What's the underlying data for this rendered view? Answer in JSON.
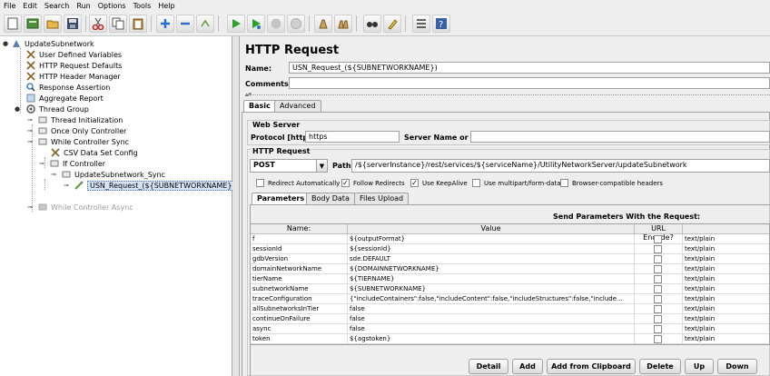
{
  "menu": [
    "File",
    "Edit",
    "Search",
    "Run",
    "Options",
    "Tools",
    "Help"
  ],
  "toolbar": {
    "icons": [
      "new-icon",
      "templates-icon",
      "open-icon",
      "save-icon",
      "cut-icon",
      "copy-icon",
      "paste-icon",
      "expand-icon",
      "collapse-icon",
      "toggle-icon",
      "start-icon",
      "start-no-pauses-icon",
      "stop-icon",
      "shutdown-icon",
      "clear-icon",
      "clear-all-icon",
      "search-icon",
      "reset-search-icon",
      "function-helper-icon",
      "help-icon"
    ]
  },
  "tree": {
    "items": [
      {
        "label": "UpdateSubnetwork",
        "icon": "test-plan-icon"
      },
      {
        "label": "User Defined Variables",
        "icon": "config-element-icon"
      },
      {
        "label": "HTTP Request Defaults",
        "icon": "config-element-icon"
      },
      {
        "label": "HTTP Header Manager",
        "icon": "config-element-icon"
      },
      {
        "label": "Response Assertion",
        "icon": "assertion-icon"
      },
      {
        "label": "Aggregate Report",
        "icon": "listener-icon"
      },
      {
        "label": "Thread Group",
        "icon": "thread-group-icon"
      },
      {
        "label": "Thread Initialization",
        "icon": "controller-icon"
      },
      {
        "label": "Once Only Controller",
        "icon": "controller-icon"
      },
      {
        "label": "While Controller Sync",
        "icon": "controller-icon"
      },
      {
        "label": "CSV Data Set Config",
        "icon": "config-element-icon"
      },
      {
        "label": "If Controller",
        "icon": "controller-icon"
      },
      {
        "label": "UpdateSubnetwork_Sync",
        "icon": "controller-icon"
      },
      {
        "label": "USN_Request_(${SUBNETWORKNAME})",
        "icon": "sampler-icon"
      },
      {
        "label": "While Controller Async",
        "icon": "controller-icon"
      }
    ]
  },
  "panel": {
    "title": "HTTP Request",
    "name_label": "Name:",
    "name_value": "USN_Request_(${SUBNETWORKNAME})",
    "comments_label": "Comments:",
    "comments_value": "",
    "tabs": [
      "Basic",
      "Advanced"
    ],
    "web_server_title": "Web Server",
    "protocol_label": "Protocol [http]:",
    "protocol_value": "https",
    "server_label": "Server Name or IP:",
    "server_value": "",
    "http_request_title": "HTTP Request",
    "method": "POST",
    "path_label": "Path:",
    "path_value": "/${serverInstance}/rest/services/${serviceName}/UtilityNetworkServer/updateSubnetwork",
    "checkboxes": [
      {
        "label": "Redirect Automatically",
        "checked": false
      },
      {
        "label": "Follow Redirects",
        "checked": true
      },
      {
        "label": "Use KeepAlive",
        "checked": true
      },
      {
        "label": "Use multipart/form-data",
        "checked": false
      },
      {
        "label": "Browser-compatible headers",
        "checked": false
      }
    ],
    "subtabs": [
      "Parameters",
      "Body Data",
      "Files Upload"
    ]
  },
  "params": {
    "heading": "Send Parameters With the Request:",
    "columns": [
      "Name:",
      "Value",
      "URL Encode?"
    ],
    "content_type": "text/plain",
    "rows": [
      {
        "name": "f",
        "value": "${outputFormat}"
      },
      {
        "name": "sessionId",
        "value": "${sessionId}"
      },
      {
        "name": "gdbVersion",
        "value": "sde.DEFAULT"
      },
      {
        "name": "domainNetworkName",
        "value": "${DOMAINNETWORKNAME}"
      },
      {
        "name": "tierName",
        "value": "${TIERNAME}"
      },
      {
        "name": "subnetworkName",
        "value": "${SUBNETWORKNAME}"
      },
      {
        "name": "traceConfiguration",
        "value": "{\"includeContainers\":false,\"includeContent\":false,\"includeStructures\":false,\"include..."
      },
      {
        "name": "allSubnetworksInTier",
        "value": "false"
      },
      {
        "name": "continueOnFailure",
        "value": "false"
      },
      {
        "name": "async",
        "value": "false"
      },
      {
        "name": "token",
        "value": "${agstoken}"
      }
    ]
  },
  "buttons": [
    "Detail",
    "Add",
    "Add from Clipboard",
    "Delete",
    "Up",
    "Down"
  ]
}
